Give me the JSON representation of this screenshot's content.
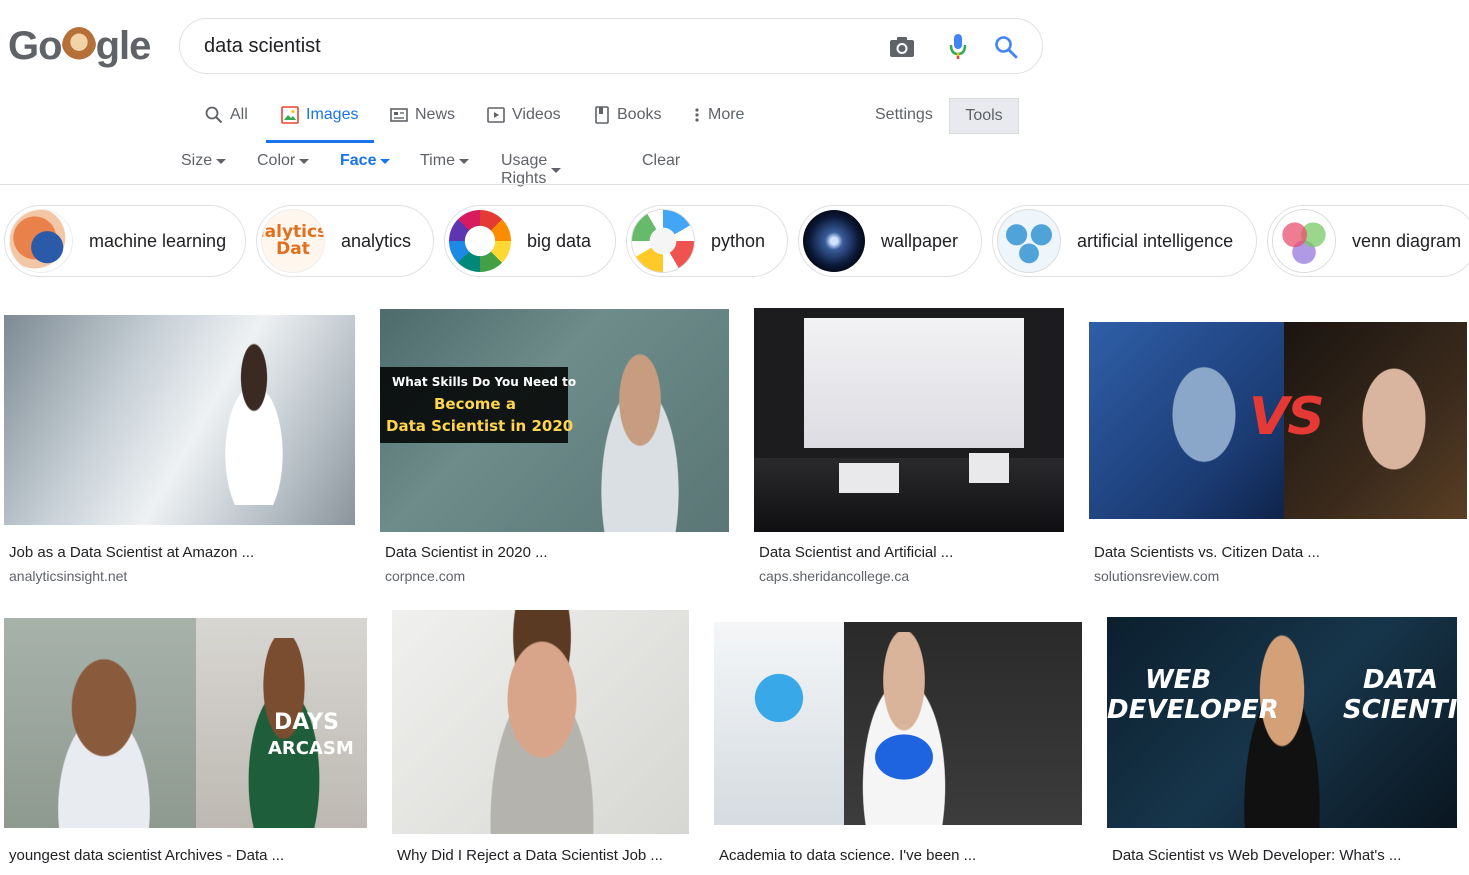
{
  "search": {
    "query": "data scientist"
  },
  "logo": {
    "letters": [
      "G",
      "o",
      "g",
      "l",
      "e"
    ]
  },
  "tabs": [
    {
      "label": "All",
      "icon": "search-icon"
    },
    {
      "label": "Images",
      "icon": "image-icon",
      "active": true
    },
    {
      "label": "News",
      "icon": "newspaper-icon"
    },
    {
      "label": "Videos",
      "icon": "play-icon"
    },
    {
      "label": "Books",
      "icon": "book-icon"
    },
    {
      "label": "More",
      "icon": "more-vert-icon"
    }
  ],
  "settings_label": "Settings",
  "tools_label": "Tools",
  "filters": [
    {
      "label": "Size"
    },
    {
      "label": "Color"
    },
    {
      "label": "Face",
      "active": true
    },
    {
      "label": "Time"
    },
    {
      "label": "Usage Rights"
    },
    {
      "label": "Clear"
    }
  ],
  "chips": [
    {
      "label": "machine learning"
    },
    {
      "label": "analytics",
      "thumb_text": "ıalytics Dat"
    },
    {
      "label": "big data"
    },
    {
      "label": "python"
    },
    {
      "label": "wallpaper"
    },
    {
      "label": "artificial intelligence"
    },
    {
      "label": "venn diagram"
    }
  ],
  "results": [
    {
      "title": "Job as a Data Scientist at Amazon ...",
      "site": "analyticsinsight.net"
    },
    {
      "title": "Data Scientist in 2020 ...",
      "site": "corpnce.com",
      "overlay": [
        "What Skills Do You Need to",
        "Become a",
        "Data Scientist in 2020"
      ]
    },
    {
      "title": "Data Scientist and Artificial ...",
      "site": "caps.sheridancollege.ca"
    },
    {
      "title": "Data Scientists vs. Citizen Data ...",
      "site": "solutionsreview.com",
      "overlay": [
        "VS"
      ]
    },
    {
      "title": "youngest data scientist Archives - Data ...",
      "site": "",
      "overlay": [
        "DAYS",
        "ARCASM"
      ]
    },
    {
      "title": "Why Did I Reject a Data Scientist Job ...",
      "site": ""
    },
    {
      "title": "Academia to data science. I've been ...",
      "site": ""
    },
    {
      "title": "Data Scientist vs Web Developer: What's ...",
      "site": "",
      "overlay": [
        "WEB",
        "DEVELOPER",
        "DATA",
        "SCIENTIST"
      ]
    }
  ],
  "colors": {
    "accent": "#1a73e8",
    "text": "#202124",
    "muted": "#5f6368"
  }
}
